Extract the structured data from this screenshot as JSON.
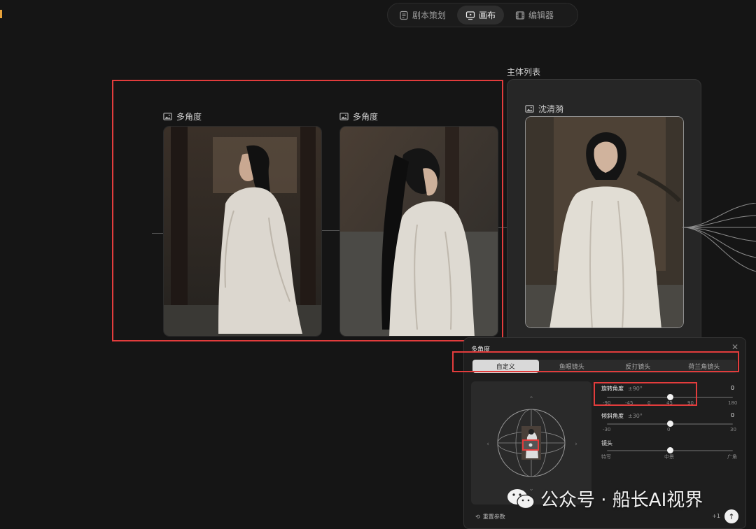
{
  "modes": [
    {
      "label": "剧本策划",
      "active": false,
      "icon": "script-icon"
    },
    {
      "label": "画布",
      "active": true,
      "icon": "canvas-icon"
    },
    {
      "label": "编辑器",
      "active": false,
      "icon": "film-icon"
    }
  ],
  "nodes": [
    {
      "title": "多角度",
      "icon": "image-icon"
    },
    {
      "title": "多角度",
      "icon": "image-icon"
    }
  ],
  "subject_panel": {
    "label": "主体列表",
    "card_title": "沈清漪",
    "icon": "image-icon"
  },
  "dialog": {
    "title": "多角度",
    "close_icon": "close-icon",
    "tabs": [
      {
        "label": "自定义",
        "active": true
      },
      {
        "label": "鱼眼镜头",
        "active": false
      },
      {
        "label": "反打镜头",
        "active": false
      },
      {
        "label": "荷兰角镜头",
        "active": false
      }
    ],
    "rotation": {
      "label": "旋转角度",
      "hint": "±90°",
      "value": "0",
      "ticks": [
        "-90",
        "-45",
        "0",
        "45",
        "90"
      ],
      "end_tick": "180",
      "level": 0.5
    },
    "tilt": {
      "label": "倾斜角度",
      "hint": "±30°",
      "value": "0",
      "ticks": [
        "-30",
        "0",
        "30"
      ],
      "level": 0.5
    },
    "lens": {
      "label": "镜头",
      "ticks": [
        "特写",
        "中景",
        "广角"
      ],
      "level": 0.5
    },
    "reset_label": "重置参数",
    "counter": "+1",
    "submit_icon": "arrow-up-icon"
  },
  "watermark": {
    "text": "公众号 · 船长AI视界",
    "icon": "wechat-icon"
  },
  "colors": {
    "background": "#151515",
    "highlight_border": "#e23c3c",
    "accent": "#e8a23a"
  }
}
